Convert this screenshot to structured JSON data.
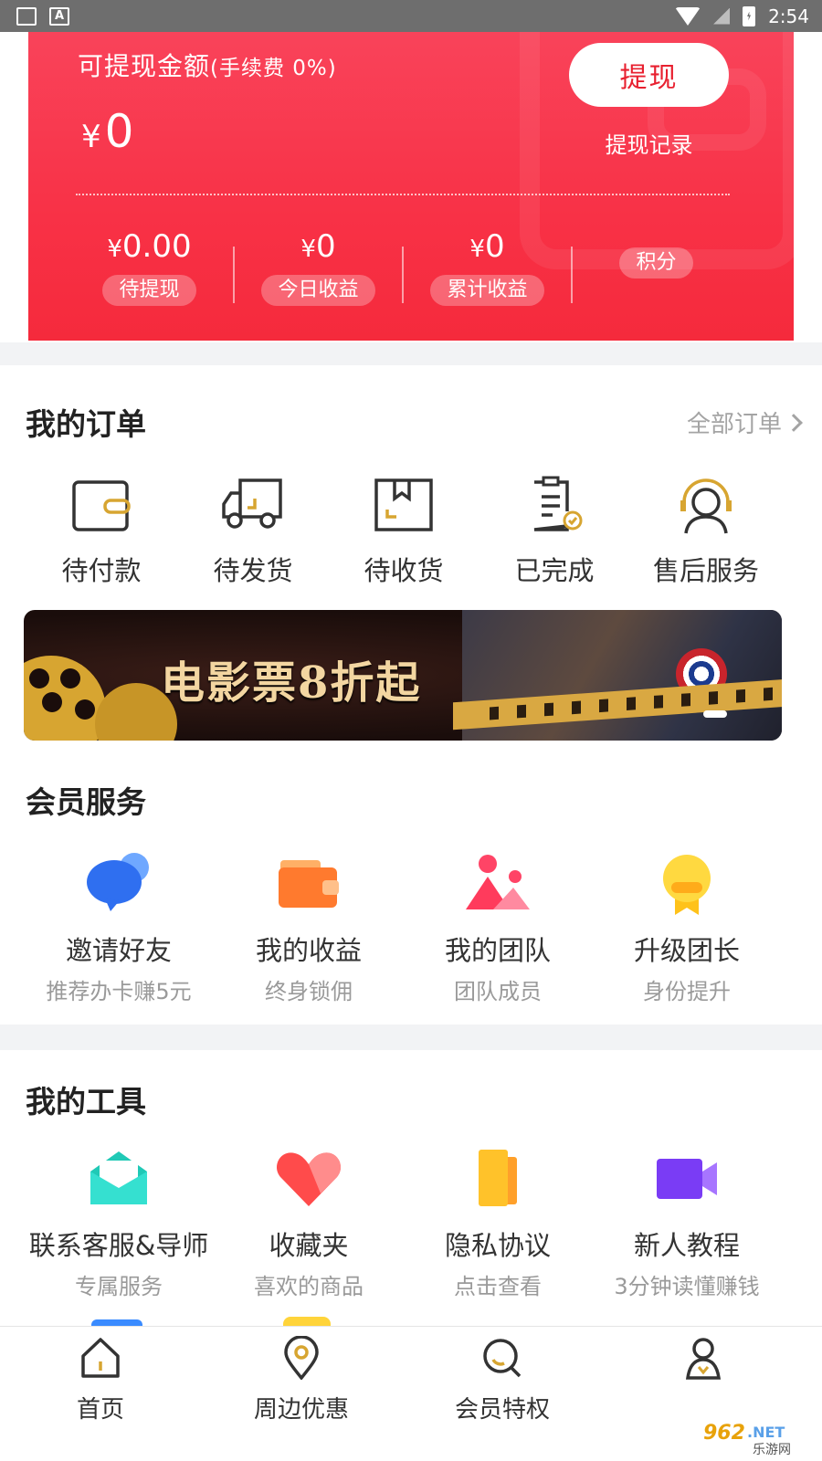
{
  "status_bar": {
    "time": "2:54"
  },
  "wallet": {
    "label": "可提现金额",
    "fee_note": "(手续费 0%)",
    "currency": "¥",
    "amount": "0",
    "withdraw_button": "提现",
    "records_link": "提现记录",
    "stats": [
      {
        "value": "0.00",
        "label": "待提现"
      },
      {
        "value": "0",
        "label": "今日收益"
      },
      {
        "value": "0",
        "label": "累计收益"
      },
      {
        "value": "",
        "label": "积分"
      }
    ]
  },
  "orders": {
    "title": "我的订单",
    "all_link": "全部订单",
    "items": [
      {
        "label": "待付款",
        "icon": "wallet-icon"
      },
      {
        "label": "待发货",
        "icon": "truck-icon"
      },
      {
        "label": "待收货",
        "icon": "package-icon"
      },
      {
        "label": "已完成",
        "icon": "clipboard-check-icon"
      },
      {
        "label": "售后服务",
        "icon": "support-agent-icon"
      }
    ]
  },
  "banner": {
    "text": "电影票8折起"
  },
  "member_services": {
    "title": "会员服务",
    "items": [
      {
        "title": "邀请好友",
        "subtitle": "推荐办卡赚5元",
        "icon": "chat-bubble-icon"
      },
      {
        "title": "我的收益",
        "subtitle": "终身锁佣",
        "icon": "wallet-orange-icon"
      },
      {
        "title": "我的团队",
        "subtitle": "团队成员",
        "icon": "team-mountain-icon"
      },
      {
        "title": "升级团长",
        "subtitle": "身份提升",
        "icon": "medal-icon"
      }
    ]
  },
  "tools": {
    "title": "我的工具",
    "items": [
      {
        "title": "联系客服&导师",
        "subtitle": "专属服务",
        "icon": "mail-icon"
      },
      {
        "title": "收藏夹",
        "subtitle": "喜欢的商品",
        "icon": "heart-icon"
      },
      {
        "title": "隐私协议",
        "subtitle": "点击查看",
        "icon": "document-icon"
      },
      {
        "title": "新人教程",
        "subtitle": "3分钟读懂赚钱",
        "icon": "video-icon"
      }
    ]
  },
  "bottom_nav": {
    "items": [
      {
        "label": "首页",
        "icon": "home-icon"
      },
      {
        "label": "周边优惠",
        "icon": "location-pin-icon"
      },
      {
        "label": "会员特权",
        "icon": "search-icon"
      },
      {
        "label": "",
        "icon": "profile-icon"
      }
    ]
  },
  "watermark": "962.NET 乐游网",
  "colors": {
    "brand_red": "#f83146",
    "accent_yellow": "#d7a531",
    "text_dark": "#222222",
    "text_gray": "#9a9a9a"
  }
}
